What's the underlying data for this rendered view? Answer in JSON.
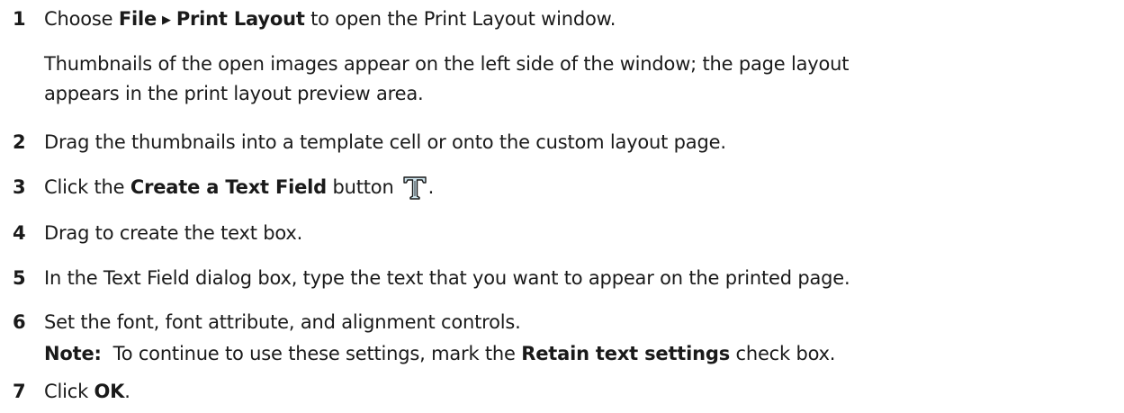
{
  "steps": [
    {
      "number": "1",
      "pre": "Choose ",
      "menu_file": "File",
      "menu_print_layout": "Print Layout",
      "post": " to open the Print Layout window.",
      "detail_line1": "Thumbnails of the open images appear on the left side of the window; the page layout",
      "detail_line2": "appears in the print layout preview area."
    },
    {
      "number": "2",
      "text": "Drag the thumbnails into a template cell or onto the custom layout page."
    },
    {
      "number": "3",
      "pre": "Click the ",
      "bold": "Create a Text Field",
      "post": " button",
      "after_icon": ".",
      "icon": "text-field-icon"
    },
    {
      "number": "4",
      "text": "Drag to create the text box."
    },
    {
      "number": "5",
      "text": "In the Text Field dialog box, type the text that you want to appear on the printed page."
    },
    {
      "number": "6",
      "text": "Set the font, font attribute, and alignment controls.",
      "note_label": "Note:",
      "note_pre": "  To continue to use these settings, mark the ",
      "note_bold": "Retain text settings",
      "note_post": " check box."
    },
    {
      "number": "7",
      "pre": "Click ",
      "bold": "OK",
      "post": "."
    }
  ],
  "colors": {
    "text": "#1a1a1a",
    "icon_fill": "#cfe6ef",
    "icon_stroke": "#1a1a1a"
  }
}
